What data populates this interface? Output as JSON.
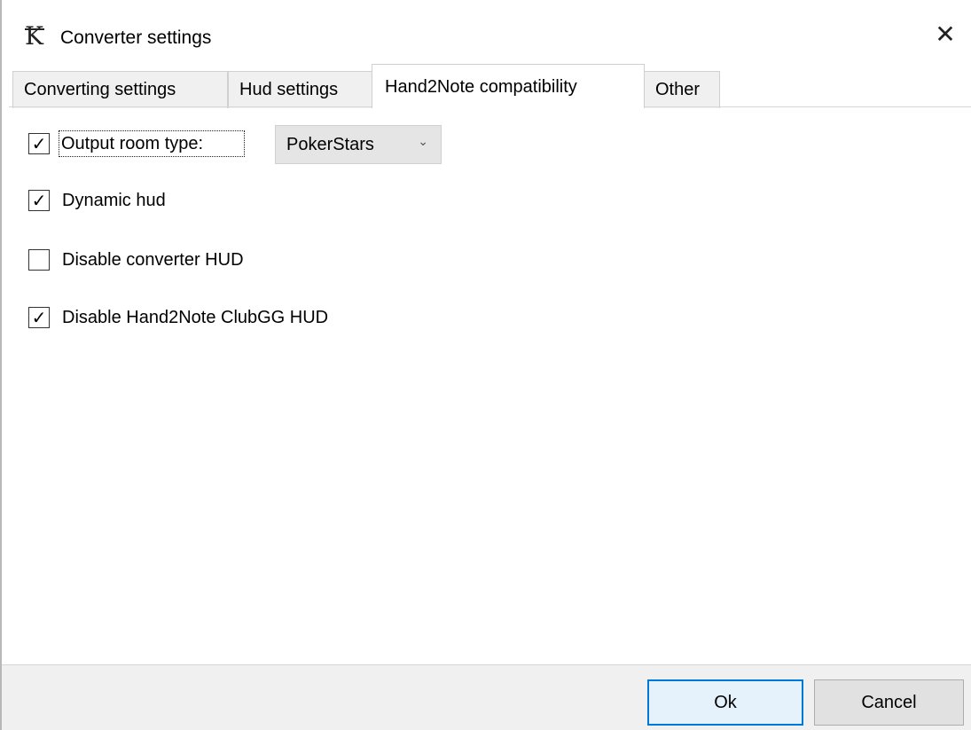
{
  "window": {
    "title": "Converter settings",
    "icon": "k-logo-icon",
    "close_glyph": "✕"
  },
  "tabs": [
    {
      "label": "Converting settings",
      "active": false
    },
    {
      "label": "Hud settings",
      "active": false
    },
    {
      "label": "Hand2Note compatibility",
      "active": true
    },
    {
      "label": "Other",
      "active": false
    }
  ],
  "options": {
    "output_room_type": {
      "label": "Output room type:",
      "checked": true,
      "check_glyph": "✓"
    },
    "room_select": {
      "value": "PokerStars",
      "chevron": "⌄"
    },
    "dynamic_hud": {
      "label": "Dynamic hud",
      "checked": true,
      "check_glyph": "✓"
    },
    "disable_converter_hud": {
      "label": "Disable converter HUD",
      "checked": false,
      "check_glyph": ""
    },
    "disable_h2n_clubgg_hud": {
      "label": "Disable Hand2Note ClubGG HUD",
      "checked": true,
      "check_glyph": "✓"
    }
  },
  "footer": {
    "ok_label": "Ok",
    "cancel_label": "Cancel"
  },
  "colors": {
    "accent": "#0078d7",
    "footer_bg": "#f0f0f0",
    "dropdown_bg": "#e5e5e5"
  }
}
